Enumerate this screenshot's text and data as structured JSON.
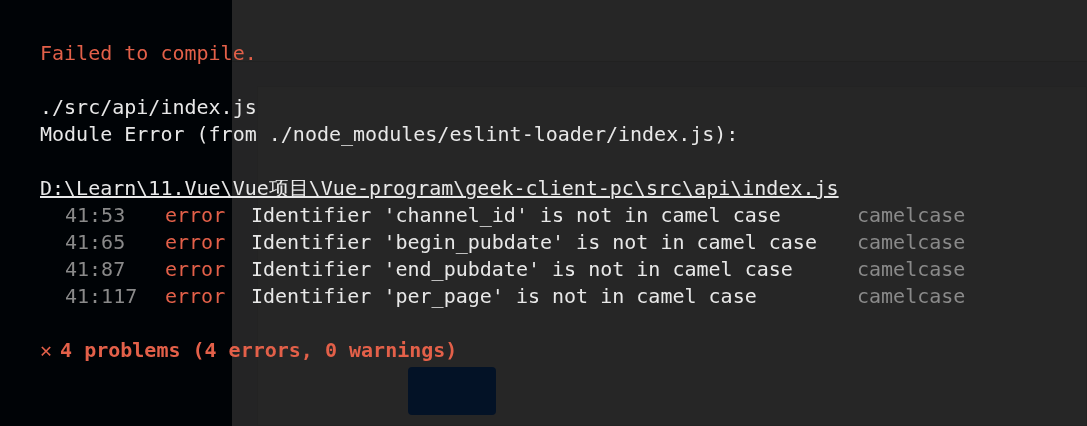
{
  "overlay": {
    "title": "Failed to compile.",
    "file": "./src/api/index.js",
    "module_error": "Module Error (from ./node_modules/eslint-loader/index.js):",
    "path": "D:\\Learn\\11.Vue\\Vue项目\\Vue-program\\geek-client-pc\\src\\api\\index.js",
    "problems": [
      {
        "position": "41:53",
        "severity": "error",
        "message": "Identifier 'channel_id' is not in camel case",
        "rule": "camelcase"
      },
      {
        "position": "41:65",
        "severity": "error",
        "message": "Identifier 'begin_pubdate' is not in camel case",
        "rule": "camelcase"
      },
      {
        "position": "41:87",
        "severity": "error",
        "message": "Identifier 'end_pubdate' is not in camel case",
        "rule": "camelcase"
      },
      {
        "position": "41:117",
        "severity": "error",
        "message": "Identifier 'per_page' is not in camel case",
        "rule": "camelcase"
      }
    ],
    "summary_icon": "✕",
    "summary": "4 problems (4 errors, 0 warnings)"
  }
}
